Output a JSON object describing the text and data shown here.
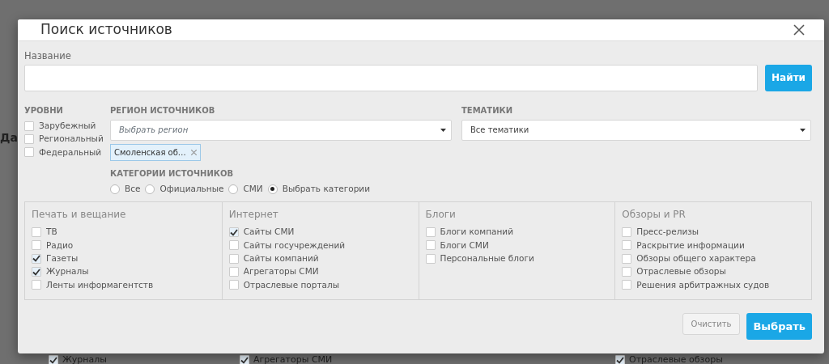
{
  "background": {
    "tab": "Да",
    "items": [
      {
        "label": "Журналы",
        "checked": true
      },
      {
        "label": "Агрегаторы СМИ",
        "checked": true
      },
      {
        "label": "Отраслевые обзоры",
        "checked": true
      }
    ]
  },
  "dialog": {
    "title": "Поиск источников",
    "name_field": {
      "label": "Название"
    },
    "search_button": "Найти",
    "levels": {
      "label": "УРОВНИ",
      "items": [
        {
          "label": "Зарубежный",
          "checked": false
        },
        {
          "label": "Региональный",
          "checked": false
        },
        {
          "label": "Федеральный",
          "checked": false
        }
      ]
    },
    "region": {
      "label": "РЕГИОН ИСТОЧНИКОВ",
      "placeholder": "Выбрать регион",
      "tags": [
        "Смоленская об…"
      ]
    },
    "themes": {
      "label": "ТЕМАТИКИ",
      "value": "Все тематики"
    },
    "categories": {
      "label": "КАТЕГОРИИ ИСТОЧНИКОВ",
      "options": [
        {
          "label": "Все",
          "selected": false
        },
        {
          "label": "Официальные",
          "selected": false
        },
        {
          "label": "СМИ",
          "selected": false
        },
        {
          "label": "Выбрать категории",
          "selected": true
        }
      ],
      "groups": [
        {
          "title": "Печать и вещание",
          "items": [
            {
              "label": "ТВ",
              "checked": false
            },
            {
              "label": "Радио",
              "checked": false
            },
            {
              "label": "Газеты",
              "checked": true
            },
            {
              "label": "Журналы",
              "checked": true
            },
            {
              "label": "Ленты информагентств",
              "checked": false
            }
          ]
        },
        {
          "title": "Интернет",
          "items": [
            {
              "label": "Сайты СМИ",
              "checked": true
            },
            {
              "label": "Сайты госучреждений",
              "checked": false
            },
            {
              "label": "Сайты компаний",
              "checked": false
            },
            {
              "label": "Агрегаторы СМИ",
              "checked": false
            },
            {
              "label": "Отраслевые порталы",
              "checked": false
            }
          ]
        },
        {
          "title": "Блоги",
          "items": [
            {
              "label": "Блоги компаний",
              "checked": false
            },
            {
              "label": "Блоги СМИ",
              "checked": false
            },
            {
              "label": "Персональные блоги",
              "checked": false
            }
          ]
        },
        {
          "title": "Обзоры и PR",
          "items": [
            {
              "label": "Пресс-релизы",
              "checked": false
            },
            {
              "label": "Раскрытие информации",
              "checked": false
            },
            {
              "label": "Обзоры общего характера",
              "checked": false
            },
            {
              "label": "Отраслевые обзоры",
              "checked": false
            },
            {
              "label": "Решения арбитражных судов",
              "checked": false
            }
          ]
        }
      ]
    },
    "buttons": [
      {
        "label": "Очистить",
        "kind": "secondary"
      },
      {
        "label": "Выбрать",
        "kind": "primary"
      }
    ]
  }
}
